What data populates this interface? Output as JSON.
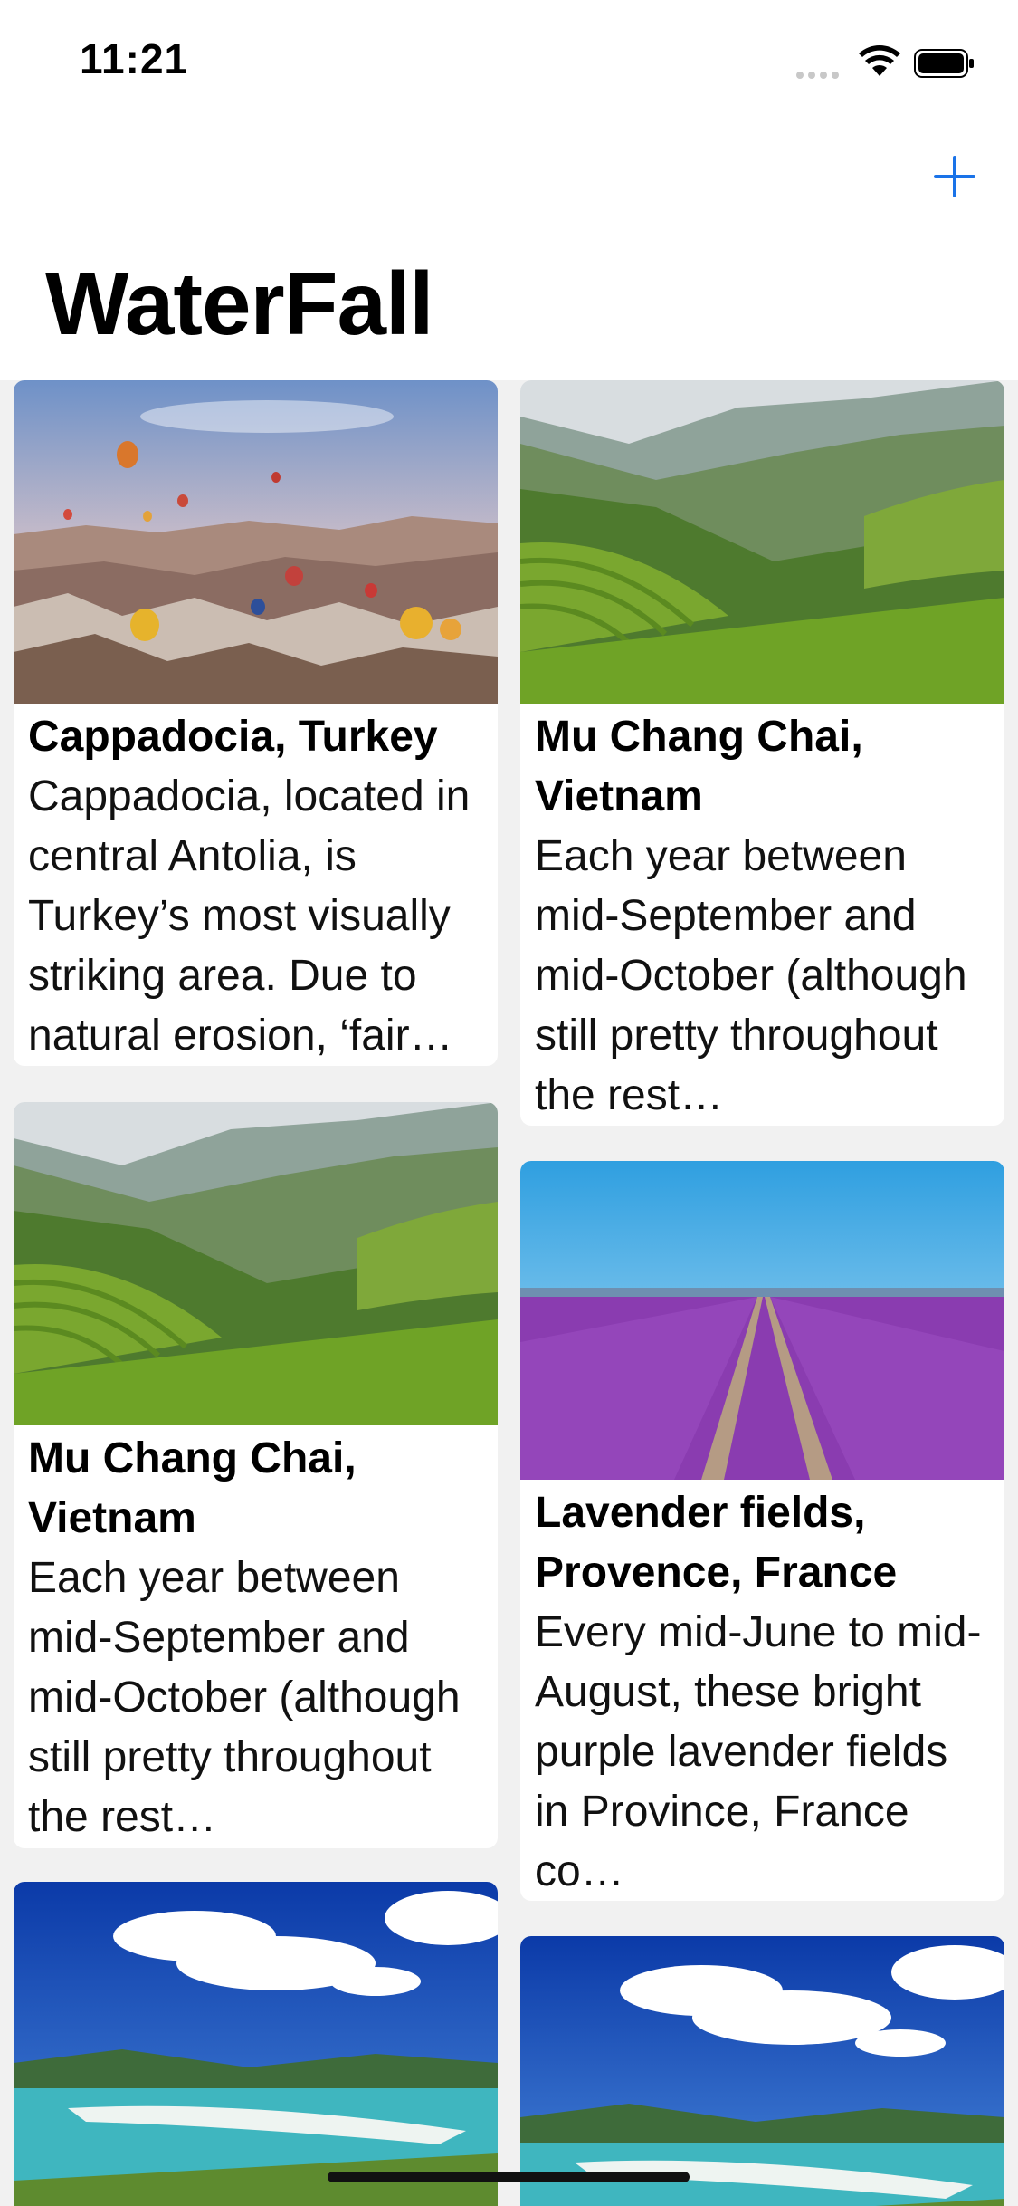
{
  "status_bar": {
    "time": "11:21"
  },
  "nav": {
    "title": "WaterFall",
    "add_icon": "plus-icon"
  },
  "colors": {
    "accent": "#1a73e8",
    "background": "#f1f1f1"
  },
  "cards": [
    {
      "title": "Cappadocia, Turkey",
      "description": "Cappadocia, located in central Antolia, is Turkey’s most visually striking area. Due to natural erosion, ‘fair…"
    },
    {
      "title": "Mu Chang Chai, Vietnam",
      "description": "Each year between mid-September and mid-October (although still pretty throughout the rest…"
    },
    {
      "title": "Mu Chang Chai, Vietnam",
      "description": "Each year between mid-September and mid-October (although still pretty throughout the rest…"
    },
    {
      "title": "Lavender fields, Provence, France",
      "description": "Every mid-June to mid-August, these bright purple lavender fields in Province, France co…"
    },
    {
      "title": "",
      "description": ""
    },
    {
      "title": "",
      "description": ""
    }
  ]
}
